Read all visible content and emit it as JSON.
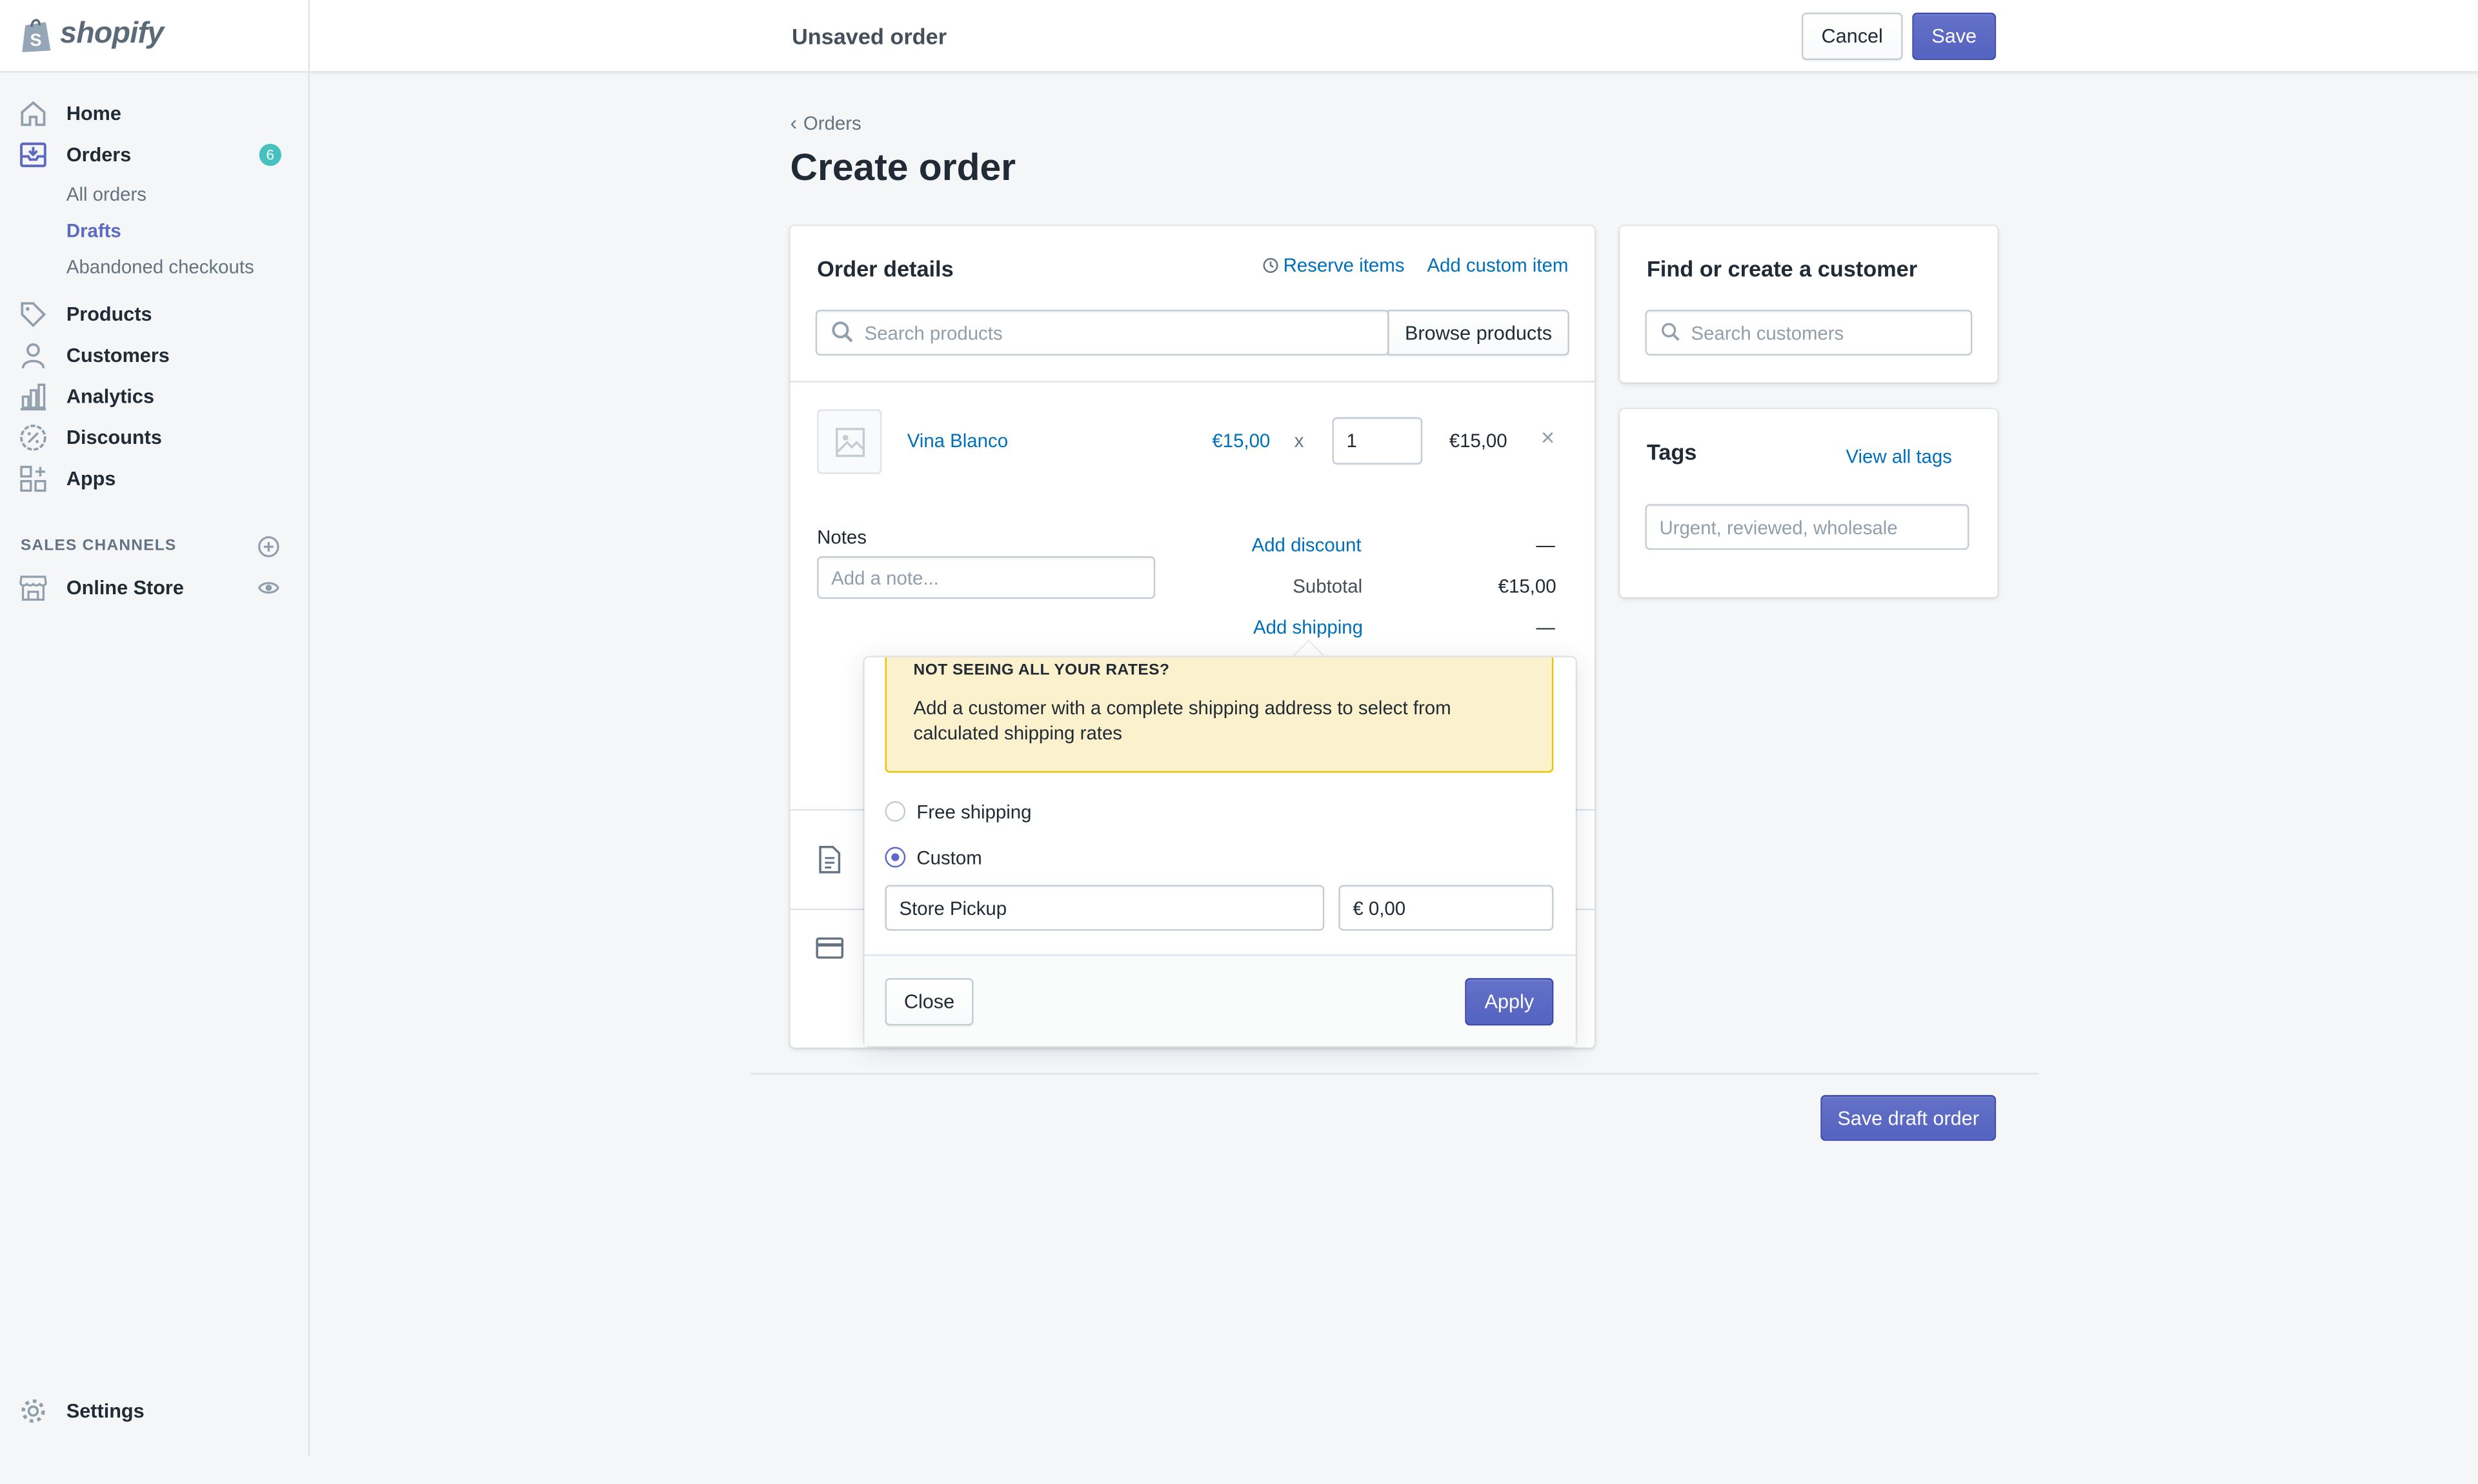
{
  "app": {
    "logo_text": "shopify",
    "page_state": "Unsaved order"
  },
  "topbar": {
    "cancel_label": "Cancel",
    "save_label": "Save"
  },
  "sidebar": {
    "items": [
      {
        "label": "Home",
        "icon": "home-icon"
      },
      {
        "label": "Orders",
        "icon": "orders-icon",
        "badge": "6"
      },
      {
        "label": "Products",
        "icon": "tag-icon"
      },
      {
        "label": "Customers",
        "icon": "person-icon"
      },
      {
        "label": "Analytics",
        "icon": "bar-chart-icon"
      },
      {
        "label": "Discounts",
        "icon": "discount-icon"
      },
      {
        "label": "Apps",
        "icon": "apps-icon"
      }
    ],
    "order_subitems": [
      "All orders",
      "Drafts",
      "Abandoned checkouts"
    ],
    "sales_channels_heading": "SALES CHANNELS",
    "online_store": "Online Store",
    "settings": "Settings"
  },
  "breadcrumb": {
    "label": "Orders"
  },
  "page": {
    "title": "Create order"
  },
  "order_details": {
    "title": "Order details",
    "reserve_items": "Reserve items",
    "add_custom_item": "Add custom item",
    "search_placeholder": "Search products",
    "browse_products": "Browse products",
    "line_item": {
      "name": "Vina Blanco",
      "price": "€15,00",
      "times": "x",
      "quantity": "1",
      "total": "€15,00",
      "remove": "×"
    },
    "notes_label": "Notes",
    "notes_placeholder": "Add a note...",
    "add_discount": "Add discount",
    "discount_value": "—",
    "subtotal_label": "Subtotal",
    "subtotal_value": "€15,00",
    "add_shipping": "Add shipping",
    "shipping_value": "—"
  },
  "shipping_popover": {
    "banner_title": "NOT SEEING ALL YOUR RATES?",
    "banner_text": "Add a customer with a complete shipping address to select from calculated shipping rates",
    "option_free": "Free shipping",
    "option_custom": "Custom",
    "custom_name_value": "Store Pickup",
    "custom_price_value": "€ 0,00",
    "close_label": "Close",
    "apply_label": "Apply"
  },
  "customer_card": {
    "title": "Find or create a customer",
    "search_placeholder": "Search customers"
  },
  "tags_card": {
    "title": "Tags",
    "view_all": "View all tags",
    "placeholder": "Urgent, reviewed, wholesale"
  },
  "footer": {
    "save_draft": "Save draft order"
  },
  "colors": {
    "primary": "#5c6ac4",
    "link": "#006fbb",
    "banner_bg": "#fcf1cd",
    "badge": "#47c1bf"
  }
}
